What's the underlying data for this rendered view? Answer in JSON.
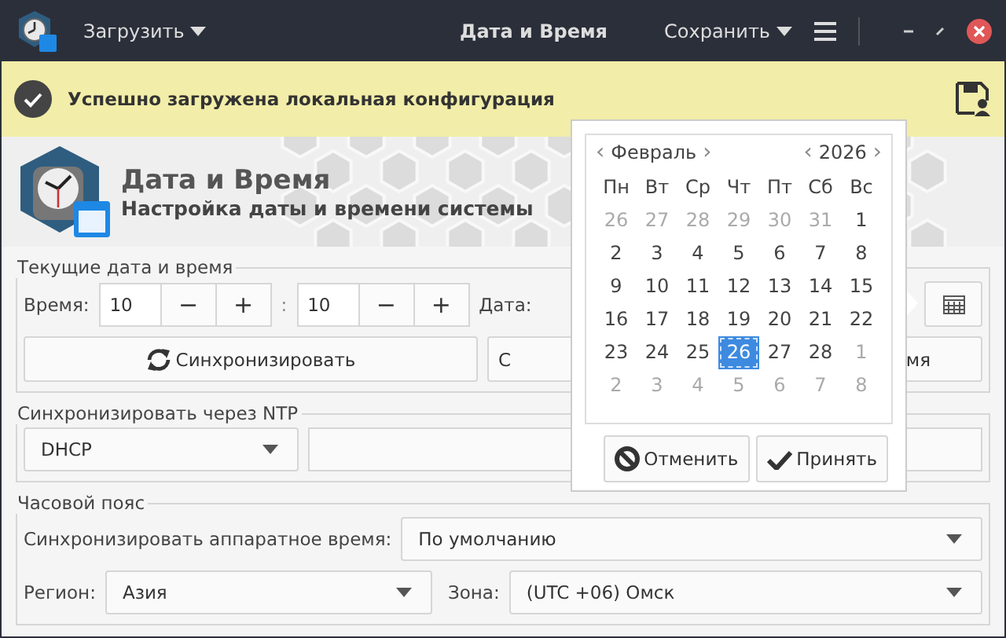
{
  "titlebar": {
    "load_menu": "Загрузить",
    "title": "Дата и Время",
    "save_menu": "Сохранить"
  },
  "notification": {
    "text": "Успешно загружена локальная конфигурация"
  },
  "header": {
    "title": "Дата и Время",
    "subtitle": "Настройка даты и времени системы"
  },
  "current": {
    "legend": "Текущие дата и время",
    "time_label": "Время:",
    "hours": "10",
    "separator": ":",
    "minutes": "10",
    "minus": "−",
    "plus": "+",
    "date_label": "Дата:",
    "sync_button": "Синхронизировать",
    "second_button_start": "С",
    "second_button_end": "мя"
  },
  "ntp": {
    "legend": "Синхронизировать через NTP",
    "mode": "DHCP"
  },
  "timezone": {
    "legend": "Часовой пояс",
    "hw_label": "Синхронизировать аппаратное время:",
    "hw_value": "По умолчанию",
    "region_label": "Регион:",
    "region": "Азия",
    "zone_label": "Зона:",
    "zone": "(UTC +06) Омск"
  },
  "calendar": {
    "prev": "‹",
    "month": "Февраль",
    "next": "›",
    "year": "2026",
    "weekdays": [
      "Пн",
      "Вт",
      "Ср",
      "Чт",
      "Пт",
      "Сб",
      "Вс"
    ],
    "weeks": [
      [
        {
          "day": "26",
          "in_month": false,
          "selected": false
        },
        {
          "day": "27",
          "in_month": false,
          "selected": false
        },
        {
          "day": "28",
          "in_month": false,
          "selected": false
        },
        {
          "day": "29",
          "in_month": false,
          "selected": false
        },
        {
          "day": "30",
          "in_month": false,
          "selected": false
        },
        {
          "day": "31",
          "in_month": false,
          "selected": false
        },
        {
          "day": "1",
          "in_month": true,
          "selected": false
        }
      ],
      [
        {
          "day": "2",
          "in_month": true,
          "selected": false
        },
        {
          "day": "3",
          "in_month": true,
          "selected": false
        },
        {
          "day": "4",
          "in_month": true,
          "selected": false
        },
        {
          "day": "5",
          "in_month": true,
          "selected": false
        },
        {
          "day": "6",
          "in_month": true,
          "selected": false
        },
        {
          "day": "7",
          "in_month": true,
          "selected": false
        },
        {
          "day": "8",
          "in_month": true,
          "selected": false
        }
      ],
      [
        {
          "day": "9",
          "in_month": true,
          "selected": false
        },
        {
          "day": "10",
          "in_month": true,
          "selected": false
        },
        {
          "day": "11",
          "in_month": true,
          "selected": false
        },
        {
          "day": "12",
          "in_month": true,
          "selected": false
        },
        {
          "day": "13",
          "in_month": true,
          "selected": false
        },
        {
          "day": "14",
          "in_month": true,
          "selected": false
        },
        {
          "day": "15",
          "in_month": true,
          "selected": false
        }
      ],
      [
        {
          "day": "16",
          "in_month": true,
          "selected": false
        },
        {
          "day": "17",
          "in_month": true,
          "selected": false
        },
        {
          "day": "18",
          "in_month": true,
          "selected": false
        },
        {
          "day": "19",
          "in_month": true,
          "selected": false
        },
        {
          "day": "20",
          "in_month": true,
          "selected": false
        },
        {
          "day": "21",
          "in_month": true,
          "selected": false
        },
        {
          "day": "22",
          "in_month": true,
          "selected": false
        }
      ],
      [
        {
          "day": "23",
          "in_month": true,
          "selected": false
        },
        {
          "day": "24",
          "in_month": true,
          "selected": false
        },
        {
          "day": "25",
          "in_month": true,
          "selected": false
        },
        {
          "day": "26",
          "in_month": true,
          "selected": true
        },
        {
          "day": "27",
          "in_month": true,
          "selected": false
        },
        {
          "day": "28",
          "in_month": true,
          "selected": false
        },
        {
          "day": "1",
          "in_month": false,
          "selected": false
        }
      ],
      [
        {
          "day": "2",
          "in_month": false,
          "selected": false
        },
        {
          "day": "3",
          "in_month": false,
          "selected": false
        },
        {
          "day": "4",
          "in_month": false,
          "selected": false
        },
        {
          "day": "5",
          "in_month": false,
          "selected": false
        },
        {
          "day": "6",
          "in_month": false,
          "selected": false
        },
        {
          "day": "7",
          "in_month": false,
          "selected": false
        },
        {
          "day": "8",
          "in_month": false,
          "selected": false
        }
      ]
    ],
    "cancel": "Отменить",
    "accept": "Принять"
  }
}
